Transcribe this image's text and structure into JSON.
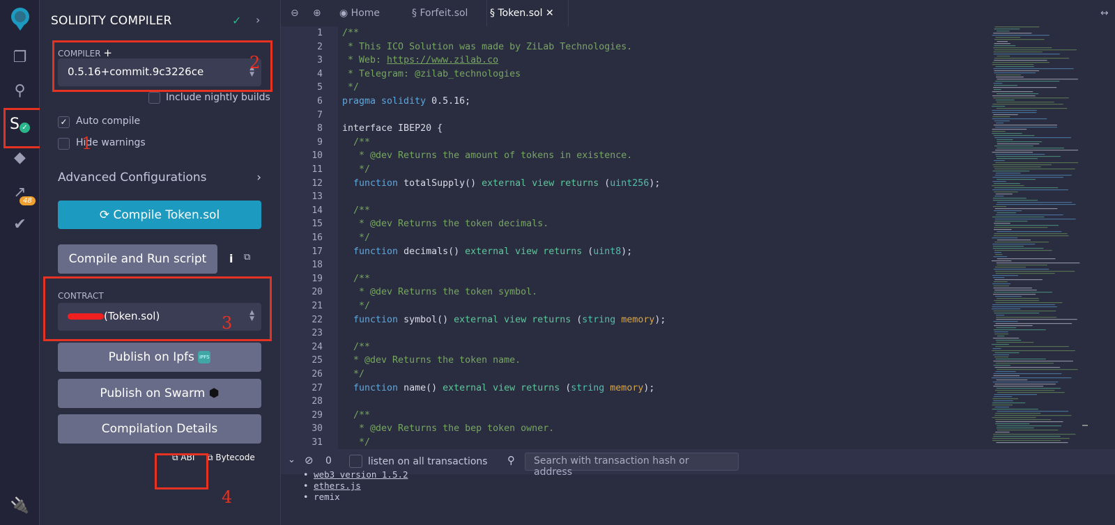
{
  "iconbar": {
    "items": [
      "logo-icon",
      "file-explorer-icon",
      "search-icon",
      "solidity-compiler-icon",
      "deploy-run-icon",
      "analysis-icon",
      "test-icon",
      "plugin-icon"
    ],
    "analysis_badge": "48"
  },
  "panel": {
    "title": "SOLIDITY COMPILER",
    "compiler_label": "COMPILER",
    "compiler_version": "0.5.16+commit.9c3226ce",
    "include_nightly": "Include nightly builds",
    "auto_compile": "Auto compile",
    "auto_compile_checked": true,
    "hide_warnings": "Hide warnings",
    "hide_warnings_checked": false,
    "advanced": "Advanced Configurations",
    "compile_button": "Compile Token.sol",
    "compile_run": "Compile and Run script",
    "contract_label": "CONTRACT",
    "contract_value": "(Token.sol)",
    "publish_ipfs": "Publish on Ipfs",
    "ipfs_logo": "IPFS",
    "publish_swarm": "Publish on Swarm",
    "compilation_details": "Compilation Details",
    "abi": "ABI",
    "bytecode": "Bytecode",
    "accent": "#1c9abf"
  },
  "annotations": [
    "1",
    "2",
    "3",
    "4"
  ],
  "editor": {
    "tabs": [
      {
        "label": "Home"
      },
      {
        "label": "Forfeit.sol"
      },
      {
        "label": "Token.sol",
        "active": true
      }
    ],
    "lines": [
      [
        [
          "c",
          "/**"
        ]
      ],
      [
        [
          "c",
          " * This ICO Solution was made by ZiLab Technologies."
        ]
      ],
      [
        [
          "c",
          " * Web: "
        ],
        [
          "u",
          "https://www.zilab.co"
        ]
      ],
      [
        [
          "c",
          " * Telegram: @zilab_technologies"
        ]
      ],
      [
        [
          "c",
          " */"
        ]
      ],
      [
        [
          "k",
          "pragma solidity "
        ],
        [
          "n",
          "0.5.16;"
        ]
      ],
      [],
      [
        [
          "n",
          "interface IBEP20 {"
        ]
      ],
      [
        [
          "c",
          "  /**"
        ]
      ],
      [
        [
          "c",
          "   * @dev Returns the amount of tokens in existence."
        ]
      ],
      [
        [
          "c",
          "   */"
        ]
      ],
      [
        [
          "k",
          "  function "
        ],
        [
          "n",
          "totalSupply() "
        ],
        [
          "g",
          "external view returns "
        ],
        [
          "n",
          "("
        ],
        [
          "t",
          "uint256"
        ],
        [
          "n",
          ");"
        ]
      ],
      [],
      [
        [
          "c",
          "  /**"
        ]
      ],
      [
        [
          "c",
          "   * @dev Returns the token decimals."
        ]
      ],
      [
        [
          "c",
          "   */"
        ]
      ],
      [
        [
          "k",
          "  function "
        ],
        [
          "n",
          "decimals() "
        ],
        [
          "g",
          "external view returns "
        ],
        [
          "n",
          "("
        ],
        [
          "t",
          "uint8"
        ],
        [
          "n",
          ");"
        ]
      ],
      [],
      [
        [
          "c",
          "  /**"
        ]
      ],
      [
        [
          "c",
          "   * @dev Returns the token symbol."
        ]
      ],
      [
        [
          "c",
          "   */"
        ]
      ],
      [
        [
          "k",
          "  function "
        ],
        [
          "n",
          "symbol() "
        ],
        [
          "g",
          "external view returns "
        ],
        [
          "n",
          "("
        ],
        [
          "t",
          "string "
        ],
        [
          "m",
          "memory"
        ],
        [
          "n",
          ");"
        ]
      ],
      [],
      [
        [
          "c",
          "  /**"
        ]
      ],
      [
        [
          "c",
          "  * @dev Returns the token name."
        ]
      ],
      [
        [
          "c",
          "  */"
        ]
      ],
      [
        [
          "k",
          "  function "
        ],
        [
          "n",
          "name() "
        ],
        [
          "g",
          "external view returns "
        ],
        [
          "n",
          "("
        ],
        [
          "t",
          "string "
        ],
        [
          "m",
          "memory"
        ],
        [
          "n",
          ");"
        ]
      ],
      [],
      [
        [
          "c",
          "  /**"
        ]
      ],
      [
        [
          "c",
          "   * @dev Returns the bep token owner."
        ]
      ],
      [
        [
          "c",
          "   */"
        ]
      ]
    ]
  },
  "terminal": {
    "count": "0",
    "listen": "listen on all transactions",
    "search_placeholder": "Search with transaction hash or address",
    "logs": [
      "web3 version 1.5.2",
      "ethers.js",
      "remix"
    ]
  }
}
